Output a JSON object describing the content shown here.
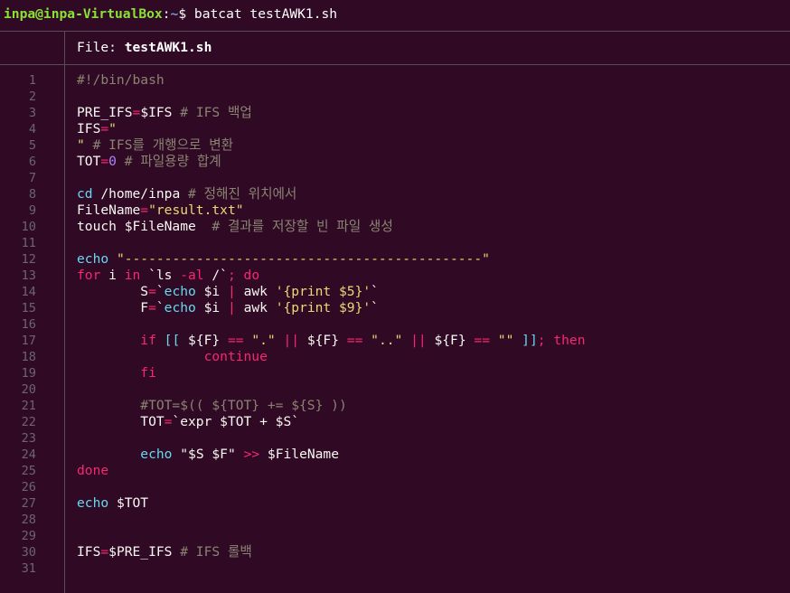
{
  "prompt": {
    "user_host": "inpa@inpa-VirtualBox",
    "path": "~",
    "symbol": "$",
    "command": "batcat testAWK1.sh"
  },
  "file_header": {
    "label": "File: ",
    "filename": "testAWK1.sh"
  },
  "line_numbers": [
    "1",
    "2",
    "3",
    "4",
    "5",
    "6",
    "7",
    "8",
    "9",
    "10",
    "11",
    "12",
    "13",
    "14",
    "15",
    "16",
    "17",
    "18",
    "19",
    "20",
    "21",
    "22",
    "23",
    "24",
    "25",
    "26",
    "27",
    "28",
    "29",
    "30",
    "31"
  ],
  "code_lines": [
    [
      {
        "t": "#!/bin/bash",
        "c": "cmt"
      }
    ],
    [],
    [
      {
        "t": "PRE_IFS",
        "c": "wt"
      },
      {
        "t": "=",
        "c": "op"
      },
      {
        "t": "$IFS ",
        "c": "wt"
      },
      {
        "t": "# IFS 백업",
        "c": "cmt"
      }
    ],
    [
      {
        "t": "IFS",
        "c": "wt"
      },
      {
        "t": "=",
        "c": "op"
      },
      {
        "t": "\"",
        "c": "str"
      }
    ],
    [
      {
        "t": "\" ",
        "c": "str"
      },
      {
        "t": "# IFS를 개행으로 변환",
        "c": "cmt"
      }
    ],
    [
      {
        "t": "TOT",
        "c": "wt"
      },
      {
        "t": "=",
        "c": "op"
      },
      {
        "t": "0",
        "c": "num"
      },
      {
        "t": " ",
        "c": "wt"
      },
      {
        "t": "# 파일용량 합계",
        "c": "cmt"
      }
    ],
    [],
    [
      {
        "t": "cd",
        "c": "cmd"
      },
      {
        "t": " /home/inpa ",
        "c": "wt"
      },
      {
        "t": "# 정해진 위치에서",
        "c": "cmt"
      }
    ],
    [
      {
        "t": "FileName",
        "c": "wt"
      },
      {
        "t": "=",
        "c": "op"
      },
      {
        "t": "\"result.txt\"",
        "c": "str"
      }
    ],
    [
      {
        "t": "touch $FileName  ",
        "c": "wt"
      },
      {
        "t": "# 결과를 저장할 빈 파일 생성",
        "c": "cmt"
      }
    ],
    [],
    [
      {
        "t": "echo",
        "c": "cmd"
      },
      {
        "t": " ",
        "c": "wt"
      },
      {
        "t": "\"---------------------------------------------\"",
        "c": "str"
      }
    ],
    [
      {
        "t": "for",
        "c": "kw"
      },
      {
        "t": " i ",
        "c": "wt"
      },
      {
        "t": "in",
        "c": "kw"
      },
      {
        "t": " `ls ",
        "c": "wt"
      },
      {
        "t": "-al",
        "c": "kw"
      },
      {
        "t": " /`",
        "c": "wt"
      },
      {
        "t": ";",
        "c": "op"
      },
      {
        "t": " ",
        "c": "wt"
      },
      {
        "t": "do",
        "c": "kw"
      }
    ],
    [
      {
        "t": "        S",
        "c": "wt"
      },
      {
        "t": "=",
        "c": "op"
      },
      {
        "t": "`",
        "c": "wt"
      },
      {
        "t": "echo",
        "c": "cmd"
      },
      {
        "t": " $i ",
        "c": "wt"
      },
      {
        "t": "|",
        "c": "op"
      },
      {
        "t": " awk ",
        "c": "wt"
      },
      {
        "t": "'{print $5}'",
        "c": "str"
      },
      {
        "t": "`",
        "c": "wt"
      }
    ],
    [
      {
        "t": "        F",
        "c": "wt"
      },
      {
        "t": "=",
        "c": "op"
      },
      {
        "t": "`",
        "c": "wt"
      },
      {
        "t": "echo",
        "c": "cmd"
      },
      {
        "t": " $i ",
        "c": "wt"
      },
      {
        "t": "|",
        "c": "op"
      },
      {
        "t": " awk ",
        "c": "wt"
      },
      {
        "t": "'{print $9}'",
        "c": "str"
      },
      {
        "t": "`",
        "c": "wt"
      }
    ],
    [],
    [
      {
        "t": "        ",
        "c": "wt"
      },
      {
        "t": "if",
        "c": "kw"
      },
      {
        "t": " ",
        "c": "wt"
      },
      {
        "t": "[[",
        "c": "cmd"
      },
      {
        "t": " ${F} ",
        "c": "wt"
      },
      {
        "t": "==",
        "c": "op"
      },
      {
        "t": " ",
        "c": "wt"
      },
      {
        "t": "\".\"",
        "c": "str"
      },
      {
        "t": " ",
        "c": "wt"
      },
      {
        "t": "||",
        "c": "op"
      },
      {
        "t": " ${F} ",
        "c": "wt"
      },
      {
        "t": "==",
        "c": "op"
      },
      {
        "t": " ",
        "c": "wt"
      },
      {
        "t": "\"..\"",
        "c": "str"
      },
      {
        "t": " ",
        "c": "wt"
      },
      {
        "t": "||",
        "c": "op"
      },
      {
        "t": " ${F} ",
        "c": "wt"
      },
      {
        "t": "==",
        "c": "op"
      },
      {
        "t": " ",
        "c": "wt"
      },
      {
        "t": "\"\"",
        "c": "str"
      },
      {
        "t": " ",
        "c": "wt"
      },
      {
        "t": "]]",
        "c": "cmd"
      },
      {
        "t": ";",
        "c": "op"
      },
      {
        "t": " ",
        "c": "wt"
      },
      {
        "t": "then",
        "c": "kw"
      }
    ],
    [
      {
        "t": "                ",
        "c": "wt"
      },
      {
        "t": "continue",
        "c": "kw"
      }
    ],
    [
      {
        "t": "        ",
        "c": "wt"
      },
      {
        "t": "fi",
        "c": "kw"
      }
    ],
    [],
    [
      {
        "t": "        #TOT=$(( ${TOT} += ${S} ))",
        "c": "cmt"
      }
    ],
    [
      {
        "t": "        TOT",
        "c": "wt"
      },
      {
        "t": "=",
        "c": "op"
      },
      {
        "t": "`expr $TOT + $S`",
        "c": "wt"
      }
    ],
    [],
    [
      {
        "t": "        ",
        "c": "wt"
      },
      {
        "t": "echo",
        "c": "cmd"
      },
      {
        "t": " ",
        "c": "wt"
      },
      {
        "t": "\"$S $F\"",
        "c": "wt"
      },
      {
        "t": " ",
        "c": "wt"
      },
      {
        "t": ">>",
        "c": "op"
      },
      {
        "t": " $FileName",
        "c": "wt"
      }
    ],
    [
      {
        "t": "done",
        "c": "kw"
      }
    ],
    [],
    [
      {
        "t": "echo",
        "c": "cmd"
      },
      {
        "t": " $TOT",
        "c": "wt"
      }
    ],
    [],
    [],
    [
      {
        "t": "IFS",
        "c": "wt"
      },
      {
        "t": "=",
        "c": "op"
      },
      {
        "t": "$PRE_IFS ",
        "c": "wt"
      },
      {
        "t": "# IFS 롤백",
        "c": "cmt"
      }
    ],
    []
  ]
}
